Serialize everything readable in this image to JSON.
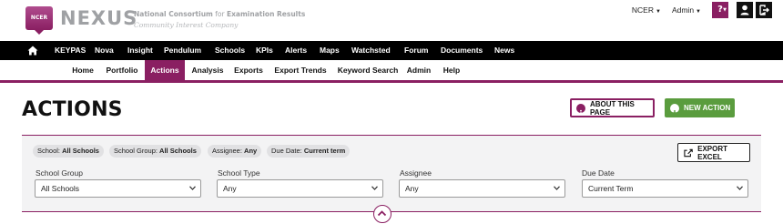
{
  "brand": {
    "badge_text": "NCER",
    "name": "NEXUS",
    "line1_strong_a": "National Consortium",
    "line1_mid": "for",
    "line1_strong_b": "Examination Results",
    "line2": "Community Interest Company"
  },
  "top_right": {
    "org_label": "NCER",
    "user_label": "Admin",
    "help_label": "?"
  },
  "nav_main": [
    "KEYPAS",
    "Nova",
    "Insight",
    "Pendulum",
    "Schools",
    "KPIs",
    "Alerts",
    "Maps",
    "Watchsted",
    "Forum",
    "Documents",
    "News"
  ],
  "nav_sub": [
    "Home",
    "Portfolio",
    "Actions",
    "Analysis",
    "Exports",
    "Export Trends",
    "Keyword Search",
    "Admin",
    "Help"
  ],
  "nav_sub_active": "Actions",
  "page": {
    "title": "ACTIONS",
    "about_label": "ABOUT THIS PAGE",
    "new_action_label": "NEW ACTION"
  },
  "filters": {
    "chips": [
      {
        "key": "School:",
        "value": "All Schools"
      },
      {
        "key": "School Group:",
        "value": "All Schools"
      },
      {
        "key": "Assignee:",
        "value": "Any"
      },
      {
        "key": "Due Date:",
        "value": "Current term"
      }
    ],
    "export_label": "EXPORT EXCEL",
    "fields": [
      {
        "label": "School Group",
        "value": "All Schools"
      },
      {
        "label": "School Type",
        "value": "Any"
      },
      {
        "label": "Assignee",
        "value": "Any"
      },
      {
        "label": "Due Date",
        "value": "Current Term"
      }
    ]
  },
  "colors": {
    "brand": "#8a1f62",
    "success": "#5a9c3e",
    "nav_bg": "#000000"
  }
}
